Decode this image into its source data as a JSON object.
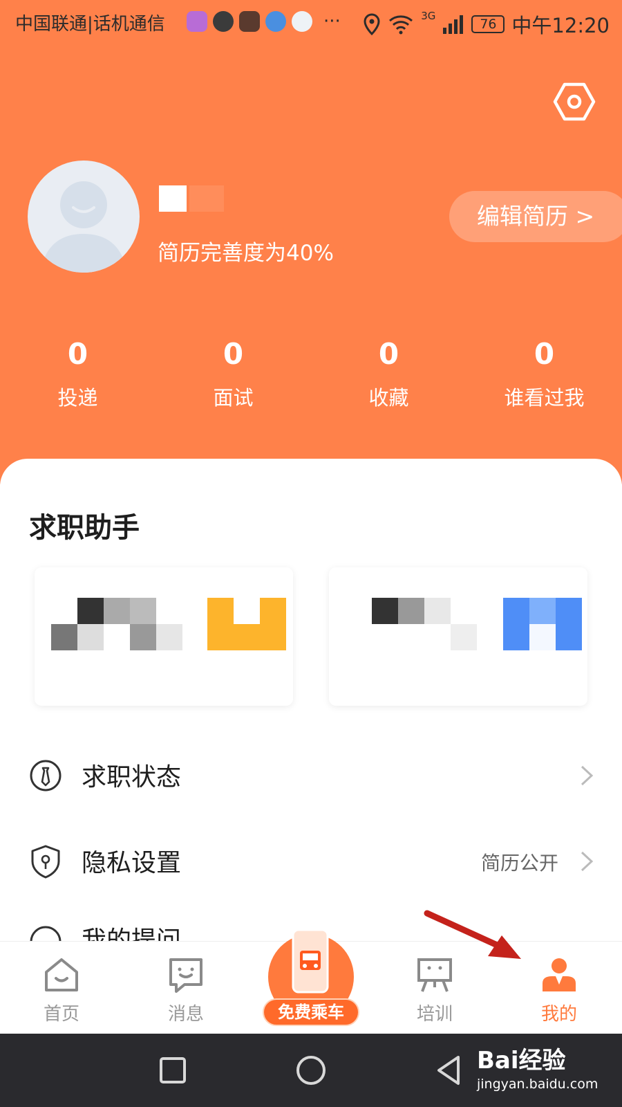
{
  "status_bar": {
    "carrier": "中国联通|话机通信",
    "dots": "···",
    "network": "3G",
    "battery": "76",
    "time": "中午12:20"
  },
  "profile": {
    "completion_text": "简历完善度为40%",
    "edit_resume_label": "编辑简历 >"
  },
  "stats": [
    {
      "value": "0",
      "label": "投递"
    },
    {
      "value": "0",
      "label": "面试"
    },
    {
      "value": "0",
      "label": "收藏"
    },
    {
      "value": "0",
      "label": "谁看过我"
    }
  ],
  "assistant": {
    "title": "求职助手"
  },
  "menu": [
    {
      "label": "求职状态",
      "value": "",
      "icon": "tie-icon"
    },
    {
      "label": "隐私设置",
      "value": "简历公开",
      "icon": "shield-icon"
    },
    {
      "label": "我的提问",
      "value": "",
      "icon": "question-icon"
    }
  ],
  "tabs": {
    "home": "首页",
    "messages": "消息",
    "free_ride": "免费乘车",
    "training": "培训",
    "mine": "我的"
  },
  "watermark": {
    "brand": "Bai经验",
    "url": "jingyan.baidu.com"
  },
  "colors": {
    "header_orange": "#ff814a",
    "active_tab": "#ff7a3d",
    "annotation_arrow": "#c4221b"
  }
}
